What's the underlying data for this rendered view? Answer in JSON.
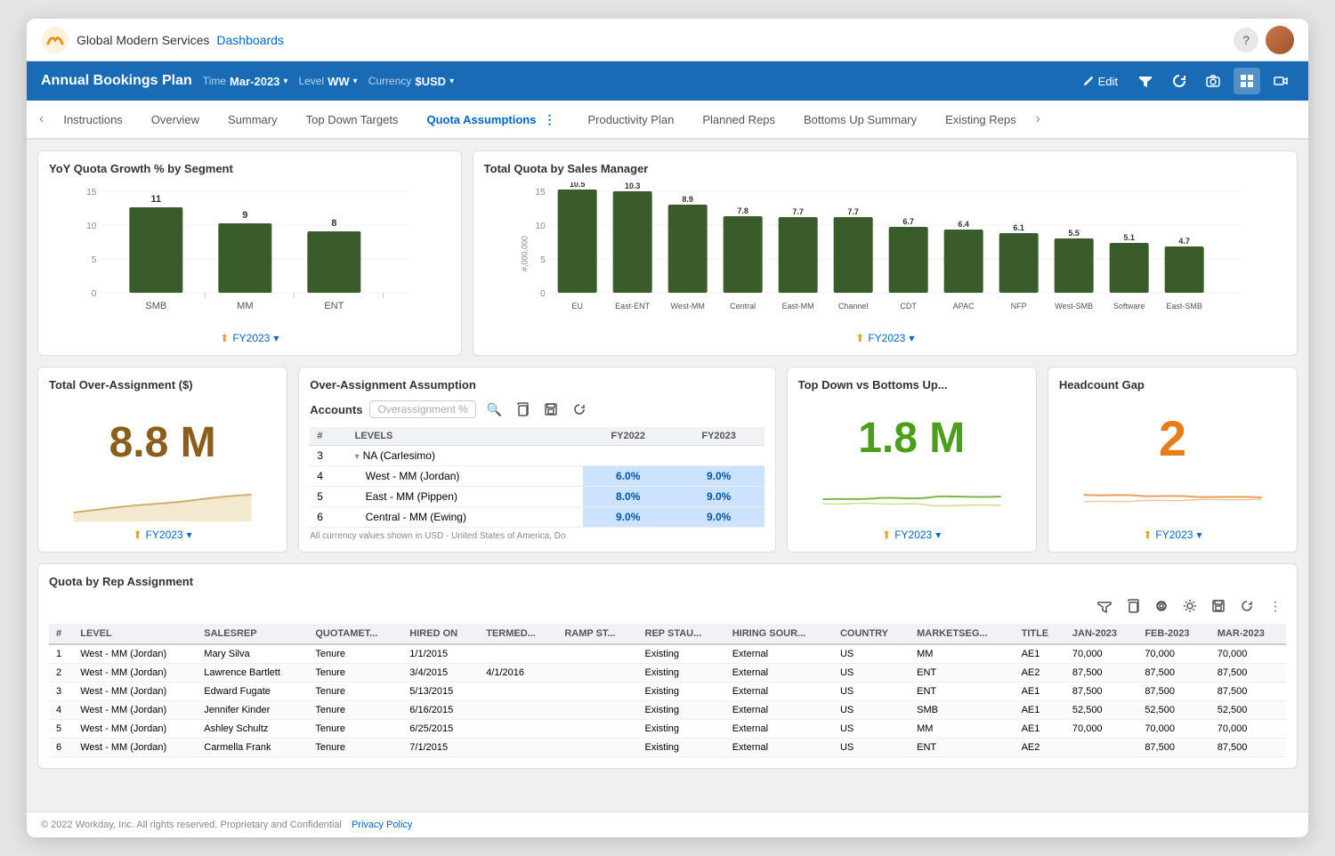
{
  "app": {
    "company": "Global Modern Services",
    "nav_link": "Dashboards",
    "help_icon": "?",
    "page_title": "Annual Bookings Plan"
  },
  "header": {
    "title": "Annual Bookings Plan",
    "time_label": "Time",
    "time_value": "Mar-2023",
    "level_label": "Level",
    "level_value": "WW",
    "currency_label": "Currency",
    "currency_value": "$USD",
    "edit_label": "Edit"
  },
  "tabs": [
    {
      "id": "instructions",
      "label": "Instructions",
      "active": false
    },
    {
      "id": "overview",
      "label": "Overview",
      "active": false
    },
    {
      "id": "summary",
      "label": "Summary",
      "active": false
    },
    {
      "id": "top-down",
      "label": "Top Down Targets",
      "active": false
    },
    {
      "id": "quota-assumptions",
      "label": "Quota Assumptions",
      "active": true
    },
    {
      "id": "productivity-plan",
      "label": "Productivity Plan",
      "active": false
    },
    {
      "id": "planned-reps",
      "label": "Planned Reps",
      "active": false
    },
    {
      "id": "bottoms-up",
      "label": "Bottoms Up Summary",
      "active": false
    },
    {
      "id": "existing-reps",
      "label": "Existing Reps",
      "active": false
    }
  ],
  "yoy_chart": {
    "title": "YoY Quota Growth % by Segment",
    "y_labels": [
      "15",
      "10",
      "5",
      "0"
    ],
    "bars": [
      {
        "label": "SMB",
        "value": 11,
        "height_pct": 73
      },
      {
        "label": "MM",
        "value": 9,
        "height_pct": 60
      },
      {
        "label": "ENT",
        "value": 8,
        "height_pct": 53
      }
    ],
    "period": "FY2023"
  },
  "quota_chart": {
    "title": "Total Quota by Sales Manager",
    "y_labels": [
      "15",
      "10",
      "5",
      "0"
    ],
    "bars": [
      {
        "label": "EU",
        "value": "10.5",
        "height_pct": 70
      },
      {
        "label": "East-ENT",
        "value": "10.3",
        "height_pct": 69
      },
      {
        "label": "West-MM",
        "value": "8.9",
        "height_pct": 59
      },
      {
        "label": "Central",
        "value": "7.8",
        "height_pct": 52
      },
      {
        "label": "East-MM",
        "value": "7.7",
        "height_pct": 51
      },
      {
        "label": "Channel",
        "value": "7.7",
        "height_pct": 51
      },
      {
        "label": "CDT",
        "value": "6.7",
        "height_pct": 45
      },
      {
        "label": "APAC",
        "value": "6.4",
        "height_pct": 43
      },
      {
        "label": "NFP",
        "value": "6.1",
        "height_pct": 41
      },
      {
        "label": "West-SMB",
        "value": "5.5",
        "height_pct": 37
      },
      {
        "label": "Software",
        "value": "5.1",
        "height_pct": 34
      },
      {
        "label": "East-SMB",
        "value": "4.7",
        "height_pct": 31
      }
    ],
    "y_axis_label": "#,000,000",
    "period": "FY2023"
  },
  "over_assignment": {
    "title": "Total Over-Assignment ($)",
    "value": "8.8 M",
    "period": "FY2023"
  },
  "over_assignment_table": {
    "title": "Over-Assignment Assumption",
    "col_accounts": "Accounts",
    "col_overassignment": "Overassignment %",
    "col_hash": "#",
    "col_levels": "LEVELS",
    "col_fy2022": "FY2022",
    "col_fy2023": "FY2023",
    "rows": [
      {
        "num": "3",
        "level": "NA (Carlesimo)",
        "fy2022": "",
        "fy2023": "",
        "indent": false,
        "is_parent": true
      },
      {
        "num": "4",
        "level": "West - MM (Jordan)",
        "fy2022": "6.0%",
        "fy2023": "9.0%",
        "indent": true
      },
      {
        "num": "5",
        "level": "East - MM (Pippen)",
        "fy2022": "8.0%",
        "fy2023": "9.0%",
        "indent": true
      },
      {
        "num": "6",
        "level": "Central - MM (Ewing)",
        "fy2022": "9.0%",
        "fy2023": "9.0%",
        "indent": true
      }
    ],
    "footer_note": "All currency values shown in USD - United States of America, Do"
  },
  "topdown": {
    "title": "Top Down vs Bottoms Up...",
    "value": "1.8 M",
    "period": "FY2023"
  },
  "headcount": {
    "title": "Headcount Gap",
    "value": "2",
    "period": "FY2023"
  },
  "quota_rep_table": {
    "title": "Quota by Rep Assignment",
    "columns": [
      "#",
      "LEVEL",
      "SALESREP",
      "QUOTAMET...",
      "HIRED ON",
      "TERMED...",
      "RAMP ST...",
      "REP STAU...",
      "HIRING SOUR...",
      "COUNTRY",
      "MARKETSEG...",
      "TITLE",
      "JAN-2023",
      "FEB-2023",
      "MAR-2023"
    ],
    "rows": [
      {
        "num": "1",
        "level": "West - MM (Jordan)",
        "salesrep": "Mary Silva",
        "quota": "Tenure",
        "hired": "1/1/2015",
        "termed": "",
        "ramp": "",
        "rep_status": "Existing",
        "hiring": "External",
        "country": "US",
        "market": "MM",
        "title": "AE1",
        "jan": "70,000",
        "feb": "70,000",
        "mar": "70,000"
      },
      {
        "num": "2",
        "level": "West - MM (Jordan)",
        "salesrep": "Lawrence Bartlett",
        "quota": "Tenure",
        "hired": "3/4/2015",
        "termed": "4/1/2016",
        "ramp": "",
        "rep_status": "Existing",
        "hiring": "External",
        "country": "US",
        "market": "ENT",
        "title": "AE2",
        "jan": "87,500",
        "feb": "87,500",
        "mar": "87,500"
      },
      {
        "num": "3",
        "level": "West - MM (Jordan)",
        "salesrep": "Edward Fugate",
        "quota": "Tenure",
        "hired": "5/13/2015",
        "termed": "",
        "ramp": "",
        "rep_status": "Existing",
        "hiring": "External",
        "country": "US",
        "market": "ENT",
        "title": "AE1",
        "jan": "87,500",
        "feb": "87,500",
        "mar": "87,500"
      },
      {
        "num": "4",
        "level": "West - MM (Jordan)",
        "salesrep": "Jennifer Kinder",
        "quota": "Tenure",
        "hired": "6/16/2015",
        "termed": "",
        "ramp": "",
        "rep_status": "Existing",
        "hiring": "External",
        "country": "US",
        "market": "SMB",
        "title": "AE1",
        "jan": "52,500",
        "feb": "52,500",
        "mar": "52,500"
      },
      {
        "num": "5",
        "level": "West - MM (Jordan)",
        "salesrep": "Ashley Schultz",
        "quota": "Tenure",
        "hired": "6/25/2015",
        "termed": "",
        "ramp": "",
        "rep_status": "Existing",
        "hiring": "External",
        "country": "US",
        "market": "MM",
        "title": "AE1",
        "jan": "70,000",
        "feb": "70,000",
        "mar": "70,000"
      },
      {
        "num": "6",
        "level": "West - MM (Jordan)",
        "salesrep": "Carmella Frank",
        "quota": "Tenure",
        "hired": "7/1/2015",
        "termed": "",
        "ramp": "",
        "rep_status": "Existing",
        "hiring": "External",
        "country": "US",
        "market": "ENT",
        "title": "AE2",
        "jan": "",
        "feb": "87,500",
        "mar": "87,500"
      }
    ]
  },
  "footer": {
    "copyright": "© 2022 Workday, Inc. All rights reserved. Proprietary and Confidential",
    "privacy_link": "Privacy Policy"
  }
}
